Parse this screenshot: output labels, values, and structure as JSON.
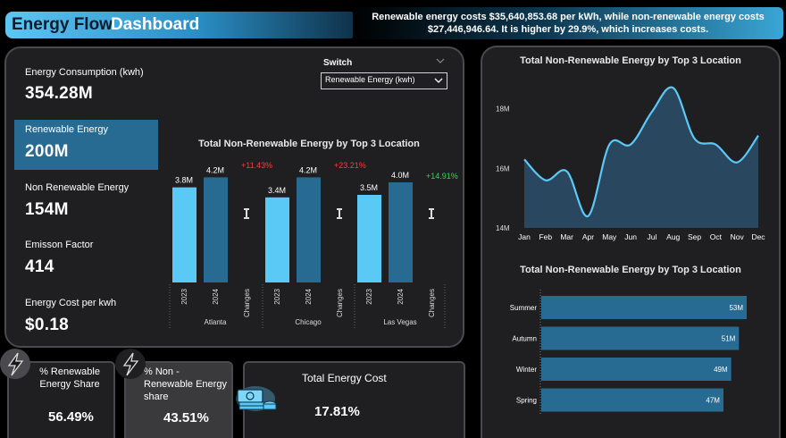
{
  "header": {
    "title_part1": "Energy Flow",
    "title_part2": "Dashboard",
    "insight": "Renewable energy costs $35,640,853.68 per kWh, while non-renewable energy costs $27,446,946.64. It is higher by 29.9%, which increases costs."
  },
  "kpis": {
    "consumption_label": "Energy Consumption (kwh)",
    "consumption_value": "354.28M",
    "renewable_label": "Renewable Energy",
    "renewable_value": "200M",
    "nonrenewable_label": "Non Renewable Energy",
    "nonrenewable_value": "154M",
    "emission_label": "Emisson Factor",
    "emission_value": "414",
    "cost_label": "Energy Cost per kwh",
    "cost_value": "$0.18"
  },
  "switch": {
    "label": "Switch",
    "selected": "Renewable Energy (kwh)"
  },
  "cards": {
    "renew_share_label": "% Renewable Energy Share",
    "renew_share_value": "56.49%",
    "nonrenew_share_label": "% Non - Renewable Energy share",
    "nonrenew_share_value": "43.51%",
    "total_cost_label": "Total Energy Cost",
    "total_cost_value": "17.81%"
  },
  "icons": {
    "lightning": "lightning-icon",
    "money": "money-icon",
    "dropdown": "chevron-down-icon"
  },
  "colors": {
    "accent": "#5bc9f5",
    "dark_bar": "#276b93",
    "negative": "#ff3b3b",
    "positive": "#39d353"
  },
  "chart_data": [
    {
      "type": "bar",
      "title": "Total Non-Renewable Energy by Top 3 Location",
      "locations": [
        "Atlanta",
        "Chicago",
        "Las Vegas"
      ],
      "categories": [
        "2023",
        "2024",
        "Changes"
      ],
      "series": [
        {
          "name": "2023",
          "values": [
            3.8,
            3.4,
            3.5
          ],
          "labels": [
            "3.8M",
            "3.4M",
            "3.5M"
          ]
        },
        {
          "name": "2024",
          "values": [
            4.2,
            4.2,
            4.0
          ],
          "labels": [
            "4.2M",
            "4.2M",
            "4.0M"
          ]
        }
      ],
      "changes": [
        "+11.43%",
        "+23.21%",
        "+14.91%"
      ],
      "change_status": [
        "negative",
        "negative",
        "positive"
      ],
      "unit": "M"
    },
    {
      "type": "area",
      "title": "Total Non-Renewable Energy by Top 3 Location",
      "x": [
        "Jan",
        "Feb",
        "Mar",
        "Apr",
        "May",
        "Jun",
        "Jul",
        "Aug",
        "Sep",
        "Oct",
        "Nov",
        "Dec"
      ],
      "values": [
        16.3,
        15.6,
        15.9,
        14.4,
        16.8,
        16.8,
        17.9,
        18.7,
        17.0,
        16.8,
        16.2,
        17.1
      ],
      "yticks": [
        "14M",
        "16M",
        "18M"
      ],
      "ylim": [
        14,
        18.8
      ],
      "grid": false
    },
    {
      "type": "bar",
      "orientation": "horizontal",
      "title": "Total Non-Renewable Energy by Top 3 Location",
      "categories": [
        "Summer",
        "Autumn",
        "Winter",
        "Spring"
      ],
      "values": [
        53,
        51,
        49,
        47
      ],
      "labels": [
        "53M",
        "51M",
        "49M",
        "47M"
      ],
      "unit": "M"
    }
  ]
}
